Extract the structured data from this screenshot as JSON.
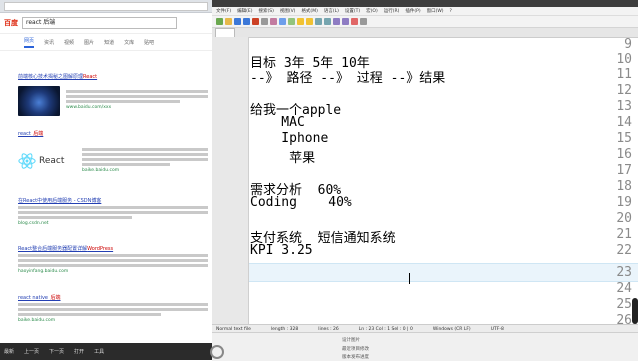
{
  "browser": {
    "search_logo": "百度",
    "search_query": "react 后端",
    "tabs": [
      "网页",
      "资讯",
      "视频",
      "图片",
      "知道",
      "文库",
      "贴吧"
    ],
    "results": [
      {
        "title": "前端核心技术揭秘之图解原理",
        "highlight": "React",
        "url": "www.baidu.com/xxx"
      },
      {
        "title": "react_",
        "highlight": "后端",
        "url": "baike.baidu.com"
      },
      {
        "title": "在React中使用后端服务 - CSDN博客",
        "highlight": "",
        "url": "blog.csdn.net"
      },
      {
        "title": "React整合后端服务器配置详解",
        "highlight": "WordPress",
        "url": "haoyinfang.baidu.com"
      },
      {
        "title": "react native_",
        "highlight": "后端",
        "url": "baike.baidu.com"
      }
    ],
    "react_logo_text": "React",
    "bottom_bar": [
      "最新",
      "上一页",
      "下一页",
      "打开",
      "工具"
    ]
  },
  "editor": {
    "menu": [
      "文件(F)",
      "编辑(E)",
      "搜索(S)",
      "视图(V)",
      "格式(M)",
      "语言(L)",
      "设置(T)",
      "宏(O)",
      "运行(R)",
      "插件(P)",
      "窗口(W)",
      "?"
    ],
    "lines": [
      {
        "no": "9",
        "text": ""
      },
      {
        "no": "10",
        "text": "目标 3年 5年 10年"
      },
      {
        "no": "11",
        "text": "--》 路径 --》 过程 --》结果"
      },
      {
        "no": "12",
        "text": ""
      },
      {
        "no": "13",
        "text": "给我一个apple"
      },
      {
        "no": "14",
        "text": "    MAC"
      },
      {
        "no": "15",
        "text": "    Iphone"
      },
      {
        "no": "16",
        "text": "     苹果"
      },
      {
        "no": "17",
        "text": ""
      },
      {
        "no": "18",
        "text": "需求分析  60%"
      },
      {
        "no": "19",
        "text": "Coding    40%"
      },
      {
        "no": "20",
        "text": ""
      },
      {
        "no": "21",
        "text": "支付系统  短信通知系统"
      },
      {
        "no": "22",
        "text": "KPI 3.25"
      },
      {
        "no": "23",
        "text": ""
      },
      {
        "no": "24",
        "text": ""
      },
      {
        "no": "25",
        "text": ""
      },
      {
        "no": "26",
        "text": ""
      }
    ],
    "status": {
      "type": "Normal text file",
      "length": "length : 328",
      "lines": "lines : 26",
      "position": "Ln : 23   Col : 1   Sel : 0 | 0",
      "eol": "Windows (CR LF)",
      "encoding": "UTF-8"
    }
  },
  "taskbar": {
    "items": [
      "设计图片",
      "最近项目修改",
      "版本发布进度"
    ]
  }
}
